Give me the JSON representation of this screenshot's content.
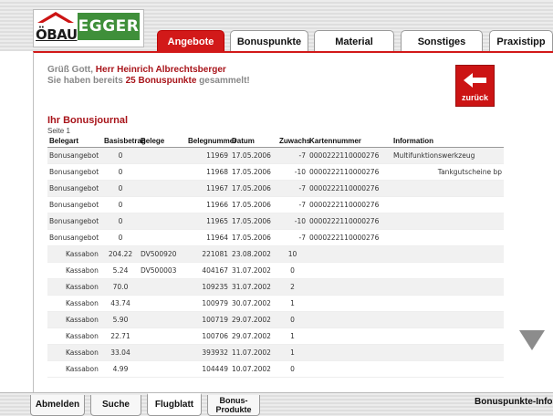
{
  "brand": {
    "obau": "ÖBAU",
    "egger": "EGGER"
  },
  "tabs": [
    {
      "label": "Angebote"
    },
    {
      "label": "Bonuspunkte"
    },
    {
      "label": "Material"
    },
    {
      "label": "Sonstiges"
    },
    {
      "label": "Praxistipp"
    }
  ],
  "greeting": {
    "prefix": "Grüß Gott, ",
    "name": "Herr Heinrich Albrechtsberger",
    "line2_prefix": "Sie haben bereits ",
    "points": "25 Bonuspunkte",
    "line2_suffix": " gesammelt!"
  },
  "back_button": {
    "label": "zurück"
  },
  "journal": {
    "title": "Ihr Bonusjournal",
    "page_label": "Seite 1",
    "columns": [
      "Belegart",
      "Basisbetrag",
      "Belege",
      "Belegnummer",
      "Datum",
      "Zuwachs",
      "Kartennummer",
      "Information"
    ],
    "rows": [
      [
        "Bonusangebot",
        "0",
        "",
        "11969",
        "17.05.2006",
        "-7",
        "0000222110000276",
        "Multifunktionswerkzeug"
      ],
      [
        "Bonusangebot",
        "0",
        "",
        "11968",
        "17.05.2006",
        "-10",
        "0000222110000276",
        "Tankgutscheine bp"
      ],
      [
        "Bonusangebot",
        "0",
        "",
        "11967",
        "17.05.2006",
        "-7",
        "0000222110000276",
        ""
      ],
      [
        "Bonusangebot",
        "0",
        "",
        "11966",
        "17.05.2006",
        "-7",
        "0000222110000276",
        ""
      ],
      [
        "Bonusangebot",
        "0",
        "",
        "11965",
        "17.05.2006",
        "-10",
        "0000222110000276",
        ""
      ],
      [
        "Bonusangebot",
        "0",
        "",
        "11964",
        "17.05.2006",
        "-7",
        "0000222110000276",
        ""
      ],
      [
        "Kassabon",
        "204.22",
        "DV500920",
        "221081",
        "23.08.2002",
        "10",
        "",
        ""
      ],
      [
        "Kassabon",
        "5.24",
        "DV500003",
        "404167",
        "31.07.2002",
        "0",
        "",
        ""
      ],
      [
        "Kassabon",
        "70.0",
        "",
        "109235",
        "31.07.2002",
        "2",
        "",
        ""
      ],
      [
        "Kassabon",
        "43.74",
        "",
        "100979",
        "30.07.2002",
        "1",
        "",
        ""
      ],
      [
        "Kassabon",
        "5.90",
        "",
        "100719",
        "29.07.2002",
        "0",
        "",
        ""
      ],
      [
        "Kassabon",
        "22.71",
        "",
        "100706",
        "29.07.2002",
        "1",
        "",
        ""
      ],
      [
        "Kassabon",
        "33.04",
        "",
        "393932",
        "11.07.2002",
        "1",
        "",
        ""
      ],
      [
        "Kassabon",
        "4.99",
        "",
        "104449",
        "10.07.2002",
        "0",
        "",
        ""
      ]
    ]
  },
  "bottom_tabs": [
    {
      "label": "Abmelden"
    },
    {
      "label": "Suche"
    },
    {
      "label": "Flugblatt"
    },
    {
      "line1": "Bonus-",
      "line2": "Produkte"
    }
  ],
  "bonus_info": "Bonuspunkte-Info",
  "icons": {
    "back": "left-arrow-icon",
    "down": "down-triangle-icon"
  },
  "colors": {
    "accent_red": "#d21919",
    "brand_green": "#3f8f3a",
    "text_dark_red": "#a8141a"
  }
}
